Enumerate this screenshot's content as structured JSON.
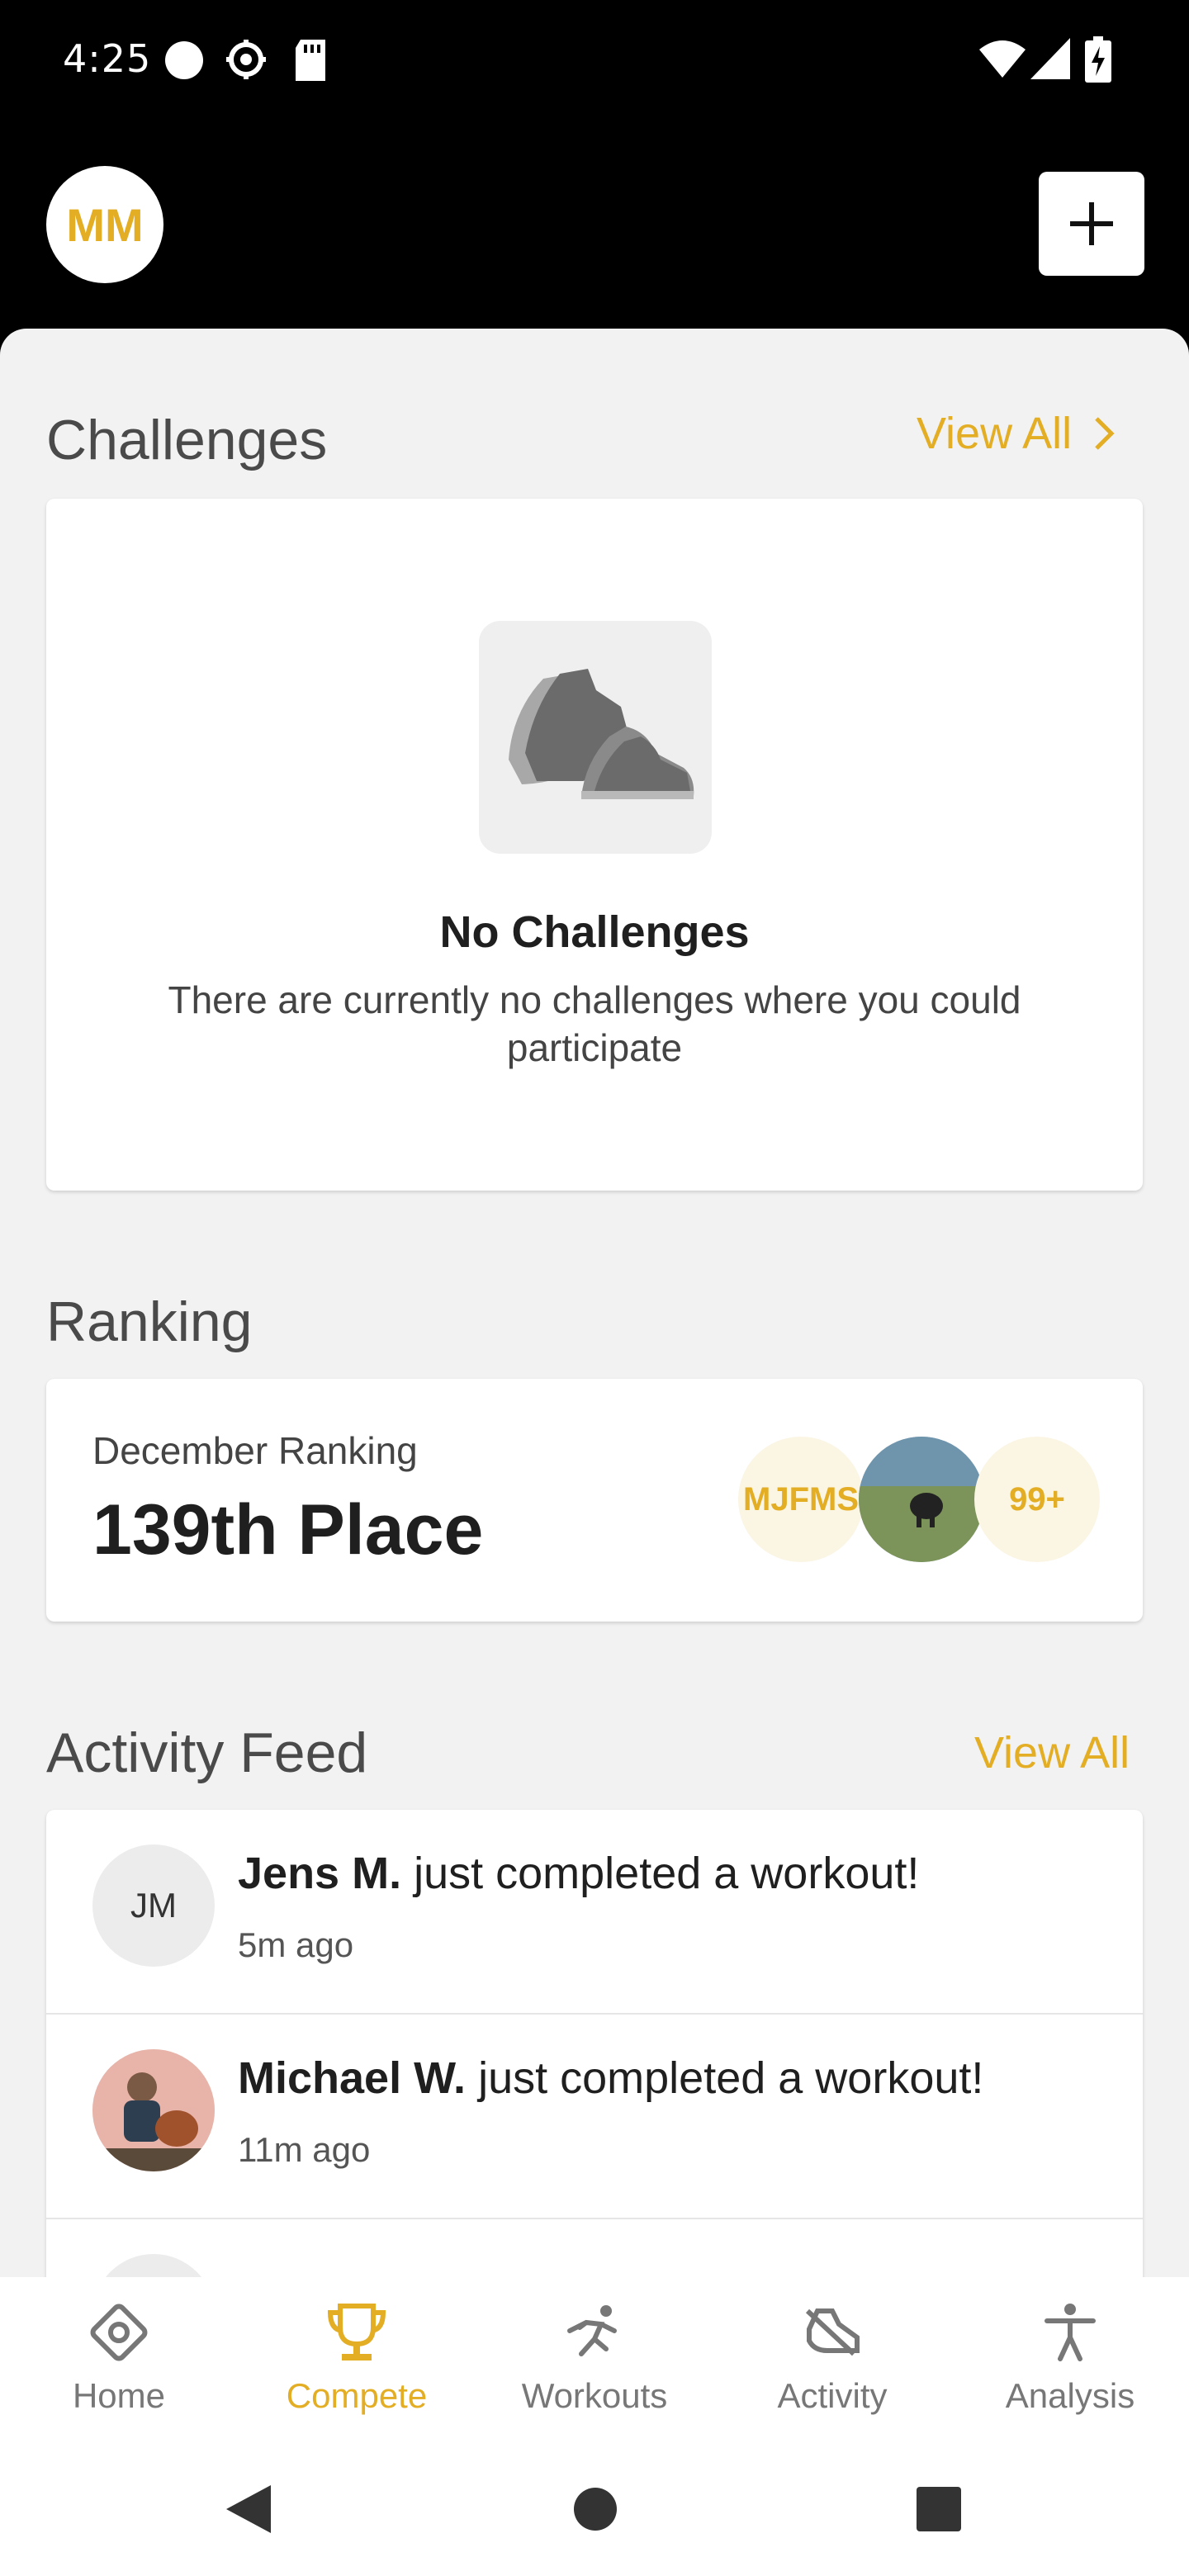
{
  "status_bar": {
    "time": "4:25"
  },
  "header": {
    "avatar_initials": "MM"
  },
  "challenges": {
    "title": "Challenges",
    "view_all": "View All",
    "empty_title": "No Challenges",
    "empty_text": "There are currently no challenges where you could participate"
  },
  "ranking": {
    "title": "Ranking",
    "label": "December Ranking",
    "value": "139th Place",
    "bubble_initials": "MJFMS",
    "bubble_more": "99+"
  },
  "feed": {
    "title": "Activity Feed",
    "view_all": "View All",
    "items": [
      {
        "initials": "JM",
        "name": "Jens M.",
        "text": "just completed a workout!",
        "time": "5m ago"
      },
      {
        "initials": "",
        "name": "Michael W.",
        "text": "just completed a workout!",
        "time": "11m ago"
      }
    ]
  },
  "nav": {
    "items": [
      {
        "label": "Home",
        "icon": "home-icon"
      },
      {
        "label": "Compete",
        "icon": "trophy-icon"
      },
      {
        "label": "Workouts",
        "icon": "runner-icon"
      },
      {
        "label": "Activity",
        "icon": "activity-shoe-icon"
      },
      {
        "label": "Analysis",
        "icon": "person-icon"
      }
    ],
    "active": "Compete"
  },
  "colors": {
    "accent": "#e3ad24",
    "background": "#f2f2f2",
    "header": "#000000"
  }
}
